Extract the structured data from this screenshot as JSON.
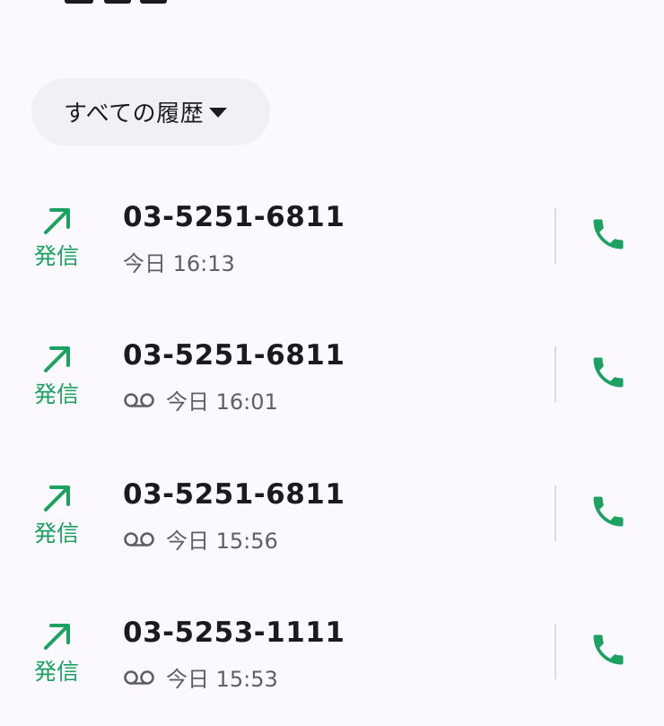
{
  "filter": {
    "label": "すべての履歴"
  },
  "colors": {
    "accent_green": "#1ba160",
    "chip_background": "#eff1f4"
  },
  "calls": [
    {
      "direction_icon": "arrow-up-right-icon",
      "direction_label": "発信",
      "number": "03-5251-6811",
      "time": "今日 16:13",
      "voicemail": false
    },
    {
      "direction_icon": "arrow-up-right-icon",
      "direction_label": "発信",
      "number": "03-5251-6811",
      "time": "今日 16:01",
      "voicemail": true
    },
    {
      "direction_icon": "arrow-up-right-icon",
      "direction_label": "発信",
      "number": "03-5251-6811",
      "time": "今日 15:56",
      "voicemail": true
    },
    {
      "direction_icon": "arrow-up-right-icon",
      "direction_label": "発信",
      "number": "03-5253-1111",
      "time": "今日 15:53",
      "voicemail": true
    }
  ]
}
